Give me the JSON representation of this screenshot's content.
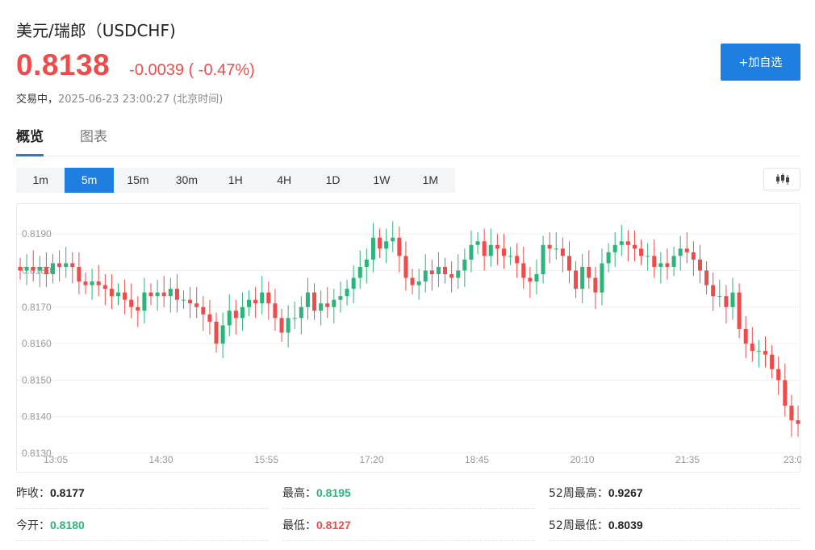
{
  "header": {
    "title": "美元/瑞郎（USDCHF)",
    "price": "0.8138",
    "change": "-0.0039 ( -0.47%)",
    "status": "交易中，",
    "timestamp": "2025-06-23 23:00:27 (北京时间)",
    "add_button": "+加自选"
  },
  "tabs": [
    {
      "label": "概览",
      "active": true
    },
    {
      "label": "图表",
      "active": false
    }
  ],
  "periods": [
    {
      "label": "1m",
      "active": false
    },
    {
      "label": "5m",
      "active": true
    },
    {
      "label": "15m",
      "active": false
    },
    {
      "label": "30m",
      "active": false
    },
    {
      "label": "1H",
      "active": false
    },
    {
      "label": "4H",
      "active": false
    },
    {
      "label": "1D",
      "active": false
    },
    {
      "label": "1W",
      "active": false
    },
    {
      "label": "1M",
      "active": false
    }
  ],
  "chart_toggle_icon": "candlestick-icon",
  "colors": {
    "up": "#2cb47b",
    "down": "#f04b4b",
    "accent": "#1f7fe0"
  },
  "chart_data": {
    "type": "candlestick",
    "y_ticks": [
      "0.8190",
      "0.8180",
      "0.8170",
      "0.8160",
      "0.8150",
      "0.8140",
      "0.8130"
    ],
    "ylim": [
      0.8128,
      0.8196
    ],
    "x_ticks": [
      "13:05",
      "14:30",
      "15:55",
      "17:20",
      "18:45",
      "20:10",
      "21:35",
      "23:0"
    ],
    "close_series": [
      0.818,
      0.8181,
      0.818,
      0.8181,
      0.8179,
      0.8182,
      0.8181,
      0.8182,
      0.8181,
      0.8177,
      0.8176,
      0.8177,
      0.8176,
      0.8175,
      0.8173,
      0.8174,
      0.8172,
      0.817,
      0.8169,
      0.8174,
      0.8173,
      0.8174,
      0.8173,
      0.8175,
      0.8172,
      0.8172,
      0.8171,
      0.817,
      0.8168,
      0.8166,
      0.816,
      0.8165,
      0.8169,
      0.8167,
      0.817,
      0.8172,
      0.8171,
      0.8174,
      0.8171,
      0.8167,
      0.8163,
      0.8167,
      0.8167,
      0.817,
      0.8174,
      0.8169,
      0.8171,
      0.817,
      0.8172,
      0.8173,
      0.8175,
      0.8178,
      0.8181,
      0.8183,
      0.8189,
      0.8186,
      0.8188,
      0.8189,
      0.8184,
      0.8178,
      0.8176,
      0.8177,
      0.818,
      0.8179,
      0.8181,
      0.8179,
      0.8178,
      0.818,
      0.8183,
      0.8187,
      0.8188,
      0.8184,
      0.8187,
      0.8186,
      0.8184,
      0.8184,
      0.8182,
      0.8178,
      0.8177,
      0.8179,
      0.8187,
      0.8186,
      0.8186,
      0.8184,
      0.818,
      0.8175,
      0.8181,
      0.8178,
      0.8174,
      0.8182,
      0.8185,
      0.8187,
      0.8188,
      0.8187,
      0.8186,
      0.8184,
      0.8184,
      0.8181,
      0.8182,
      0.8181,
      0.8184,
      0.8186,
      0.8185,
      0.8183,
      0.818,
      0.8176,
      0.8173,
      0.8173,
      0.817,
      0.8174,
      0.8164,
      0.816,
      0.8158,
      0.8158,
      0.8157,
      0.8153,
      0.815,
      0.8143,
      0.8139,
      0.8138
    ]
  },
  "stats": [
    {
      "label": "昨收：",
      "value": "0.8177",
      "tone": "neutral"
    },
    {
      "label": "最高：",
      "value": "0.8195",
      "tone": "up"
    },
    {
      "label": "52周最高：",
      "value": "0.9267",
      "tone": "neutral"
    },
    {
      "label": "今开：",
      "value": "0.8180",
      "tone": "up"
    },
    {
      "label": "最低：",
      "value": "0.8127",
      "tone": "down"
    },
    {
      "label": "52周最低：",
      "value": "0.8039",
      "tone": "neutral"
    }
  ]
}
